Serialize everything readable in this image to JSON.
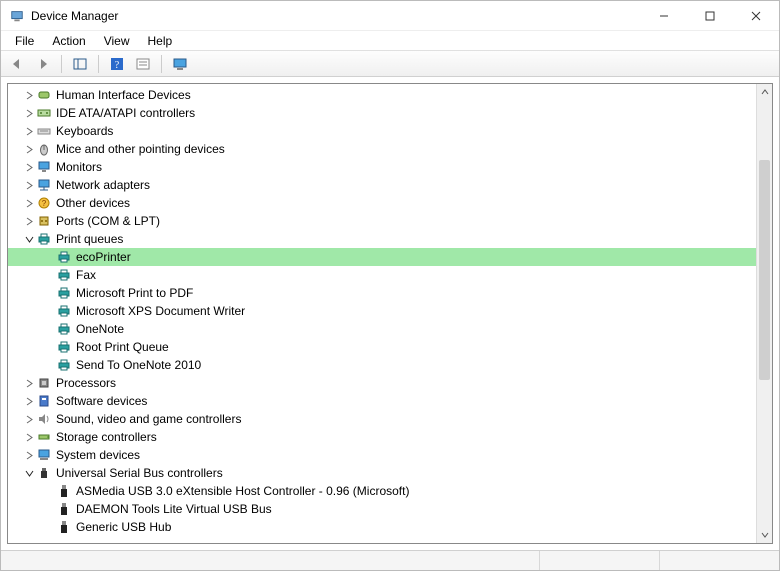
{
  "window": {
    "title": "Device Manager"
  },
  "menubar": {
    "items": [
      "File",
      "Action",
      "View",
      "Help"
    ]
  },
  "toolbar": {
    "buttons": [
      {
        "name": "back-button",
        "icon": "arrow-left-icon"
      },
      {
        "name": "forward-button",
        "icon": "arrow-right-icon"
      },
      {
        "sep": true
      },
      {
        "name": "show-hide-console-button",
        "icon": "panel-icon"
      },
      {
        "sep": true
      },
      {
        "name": "help-button",
        "icon": "help-icon"
      },
      {
        "name": "properties-button",
        "icon": "properties-icon"
      },
      {
        "sep": true
      },
      {
        "name": "scan-hardware-button",
        "icon": "monitor-scan-icon"
      }
    ]
  },
  "tree": {
    "rows": [
      {
        "depth": 1,
        "expander": "collapsed",
        "icon": "hid-icon",
        "label": "Human Interface Devices"
      },
      {
        "depth": 1,
        "expander": "collapsed",
        "icon": "ide-icon",
        "label": "IDE ATA/ATAPI controllers"
      },
      {
        "depth": 1,
        "expander": "collapsed",
        "icon": "keyboard-icon",
        "label": "Keyboards"
      },
      {
        "depth": 1,
        "expander": "collapsed",
        "icon": "mouse-icon",
        "label": "Mice and other pointing devices"
      },
      {
        "depth": 1,
        "expander": "collapsed",
        "icon": "monitor-icon",
        "label": "Monitors"
      },
      {
        "depth": 1,
        "expander": "collapsed",
        "icon": "network-icon",
        "label": "Network adapters"
      },
      {
        "depth": 1,
        "expander": "collapsed",
        "icon": "other-icon",
        "label": "Other devices"
      },
      {
        "depth": 1,
        "expander": "collapsed",
        "icon": "port-icon",
        "label": "Ports (COM & LPT)"
      },
      {
        "depth": 1,
        "expander": "expanded",
        "icon": "printer-icon",
        "label": "Print queues"
      },
      {
        "depth": 2,
        "expander": "none",
        "icon": "printer-icon",
        "label": "ecoPrinter",
        "selected": true
      },
      {
        "depth": 2,
        "expander": "none",
        "icon": "printer-icon",
        "label": "Fax"
      },
      {
        "depth": 2,
        "expander": "none",
        "icon": "printer-icon",
        "label": "Microsoft Print to PDF"
      },
      {
        "depth": 2,
        "expander": "none",
        "icon": "printer-icon",
        "label": "Microsoft XPS Document Writer"
      },
      {
        "depth": 2,
        "expander": "none",
        "icon": "printer-icon",
        "label": "OneNote"
      },
      {
        "depth": 2,
        "expander": "none",
        "icon": "printer-icon",
        "label": "Root Print Queue"
      },
      {
        "depth": 2,
        "expander": "none",
        "icon": "printer-icon",
        "label": "Send To OneNote 2010"
      },
      {
        "depth": 1,
        "expander": "collapsed",
        "icon": "cpu-icon",
        "label": "Processors"
      },
      {
        "depth": 1,
        "expander": "collapsed",
        "icon": "software-icon",
        "label": "Software devices"
      },
      {
        "depth": 1,
        "expander": "collapsed",
        "icon": "sound-icon",
        "label": "Sound, video and game controllers"
      },
      {
        "depth": 1,
        "expander": "collapsed",
        "icon": "storage-icon",
        "label": "Storage controllers"
      },
      {
        "depth": 1,
        "expander": "collapsed",
        "icon": "system-icon",
        "label": "System devices"
      },
      {
        "depth": 1,
        "expander": "expanded",
        "icon": "usb-icon",
        "label": "Universal Serial Bus controllers"
      },
      {
        "depth": 2,
        "expander": "none",
        "icon": "usb-plug-icon",
        "label": "ASMedia USB 3.0 eXtensible Host Controller - 0.96 (Microsoft)"
      },
      {
        "depth": 2,
        "expander": "none",
        "icon": "usb-plug-icon",
        "label": "DAEMON Tools Lite Virtual USB Bus"
      },
      {
        "depth": 2,
        "expander": "none",
        "icon": "usb-plug-icon",
        "label": "Generic USB Hub"
      }
    ]
  }
}
